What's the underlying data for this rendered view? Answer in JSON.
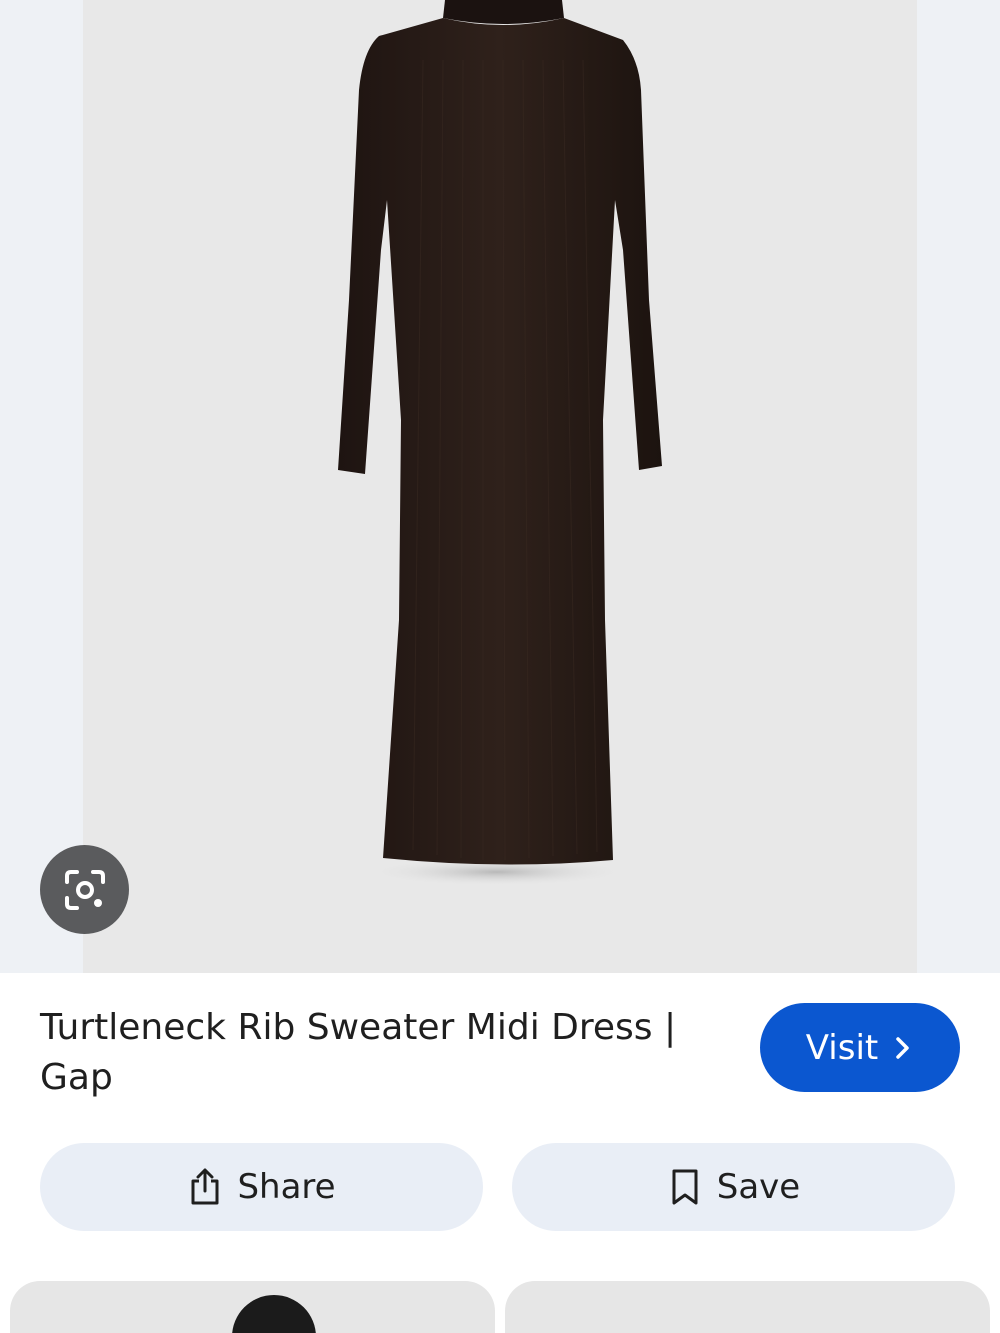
{
  "result": {
    "title": "Turtleneck Rib Sweater Midi Dress | Gap",
    "visit_label": "Visit",
    "share_label": "Share",
    "save_label": "Save"
  },
  "icons": {
    "lens": "google-lens-icon",
    "visit": "chevron-right-icon",
    "share": "share-icon",
    "save": "bookmark-icon"
  },
  "colors": {
    "accent": "#0b57d0",
    "pill_bg": "#e9eef6",
    "dress": "#2a1d18"
  }
}
